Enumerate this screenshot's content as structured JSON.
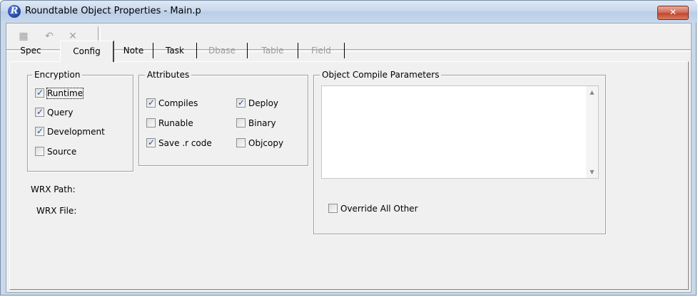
{
  "window": {
    "title": "Roundtable Object Properties - Main.p",
    "app_icon_letter": "R",
    "close_glyph": "✕"
  },
  "toolbar": {
    "save_icon": "▦",
    "undo_icon": "↶",
    "delete_icon": "✕"
  },
  "tabs": [
    {
      "label": "Spec",
      "enabled": true
    },
    {
      "label": "Config",
      "enabled": true,
      "active": true
    },
    {
      "label": "Note",
      "enabled": true
    },
    {
      "label": "Task",
      "enabled": true
    },
    {
      "label": "Dbase",
      "enabled": false
    },
    {
      "label": "Table",
      "enabled": false
    },
    {
      "label": "Field",
      "enabled": false
    }
  ],
  "encryption": {
    "legend": "Encryption",
    "items": [
      {
        "label": "Runtime",
        "checked": true
      },
      {
        "label": "Query",
        "checked": true
      },
      {
        "label": "Development",
        "checked": true
      },
      {
        "label": "Source",
        "checked": false
      }
    ]
  },
  "attributes": {
    "legend": "Attributes",
    "items": [
      {
        "label": "Compiles",
        "checked": true
      },
      {
        "label": "Deploy",
        "checked": true
      },
      {
        "label": "Runable",
        "checked": false
      },
      {
        "label": "Binary",
        "checked": false
      },
      {
        "label": "Save .r code",
        "checked": true
      },
      {
        "label": "Objcopy",
        "checked": false
      }
    ]
  },
  "compile_params": {
    "legend": "Object Compile Parameters",
    "value": "",
    "override_label": "Override All Other",
    "override_checked": false
  },
  "wrx": {
    "path_label": "WRX Path:",
    "file_label": "WRX File:"
  }
}
